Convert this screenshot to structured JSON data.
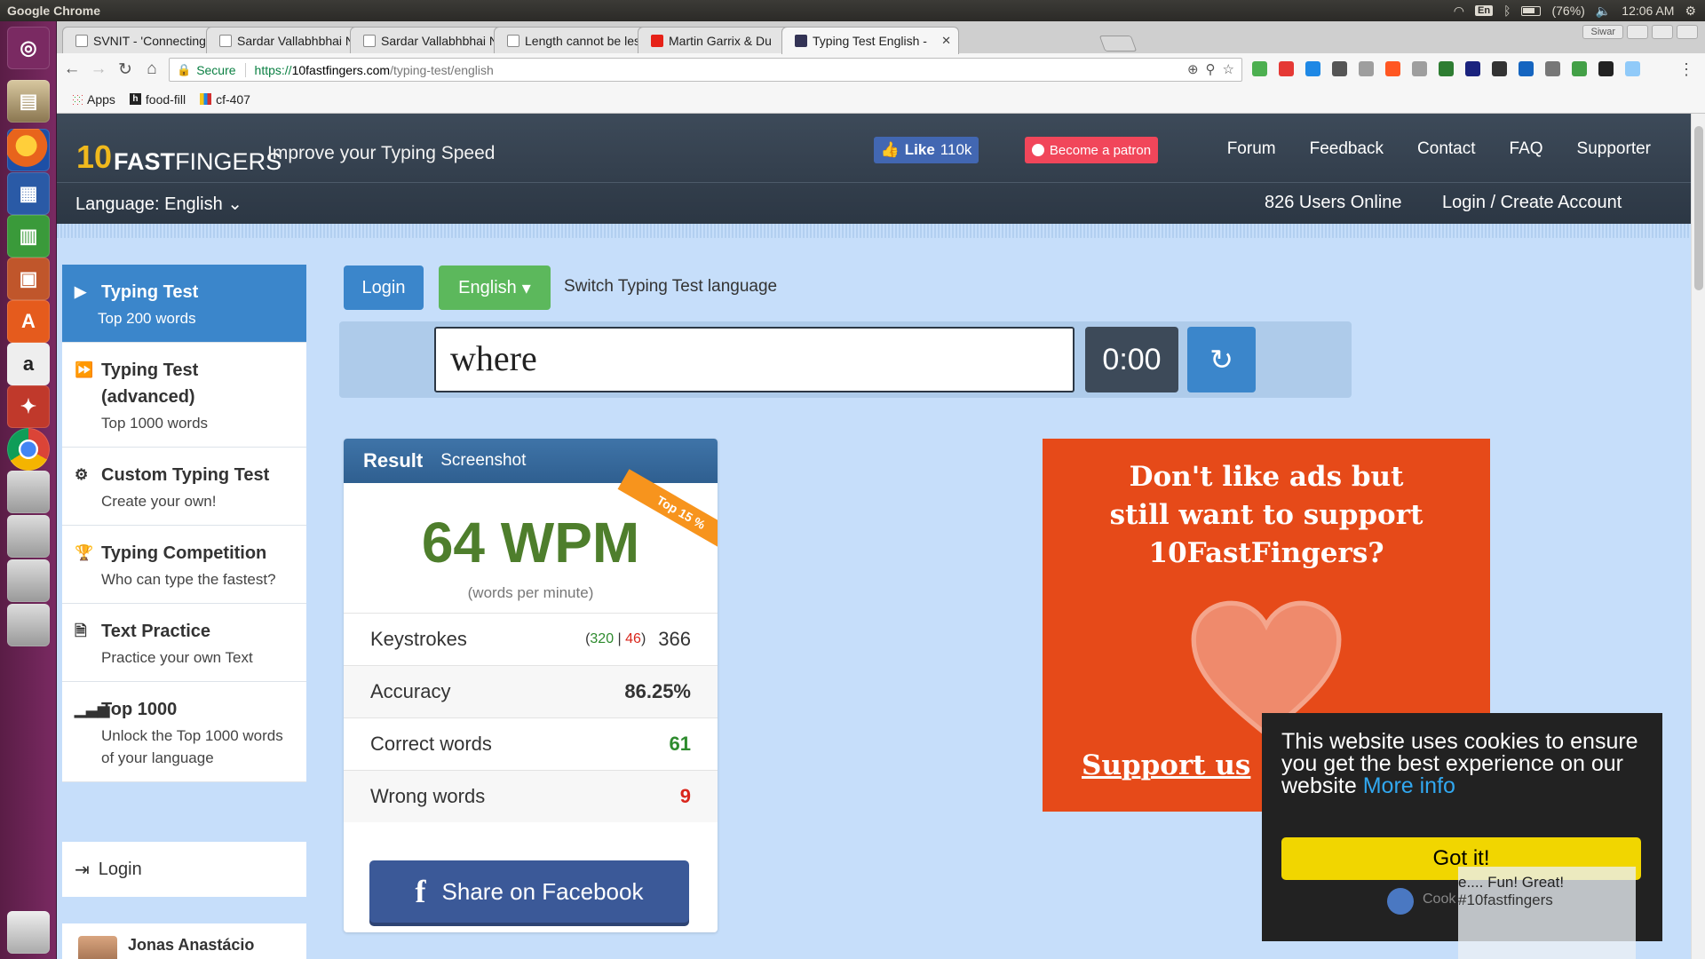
{
  "os": {
    "app_title": "Google Chrome",
    "lang": "En",
    "battery": "(76%)",
    "time": "12:06 AM"
  },
  "browser": {
    "tabs": [
      {
        "title": "SVNIT - 'Connecting I",
        "favicon": "doc-icon"
      },
      {
        "title": "Sardar Vallabhbhai N",
        "favicon": "shield-icon"
      },
      {
        "title": "Sardar Vallabhbhai N",
        "favicon": "doc-icon"
      },
      {
        "title": "Length cannot be les",
        "favicon": "doc-icon"
      },
      {
        "title": "Martin Garrix & Du",
        "favicon": "youtube-icon"
      },
      {
        "title": "Typing Test English -",
        "favicon": "tenff-icon"
      }
    ],
    "user_chip": "Siwar",
    "address": {
      "secure_label": "Secure",
      "scheme": "https://",
      "host": "10fastfingers.com",
      "path": "/typing-test/english"
    },
    "bookmarks": [
      {
        "label": "Apps"
      },
      {
        "label": "food-fill"
      },
      {
        "label": "cf-407"
      }
    ],
    "extension_colors": [
      "#4caf50",
      "#e53935",
      "#1e88e5",
      "#555555",
      "#9e9e9e",
      "#ff5722",
      "#9e9e9e",
      "#2e7d32",
      "#1a237e",
      "#333333",
      "#1565c0",
      "#777777",
      "#43a047",
      "#222222",
      "#90caf9"
    ]
  },
  "site": {
    "logo_ten": "10",
    "logo_fast": "FAST",
    "logo_fingers": "FINGERS",
    "tagline": "Improve your Typing Speed",
    "like_label": "Like",
    "like_count": "110k",
    "patron_label": "Become a patron",
    "nav": [
      "Forum",
      "Feedback",
      "Contact",
      "FAQ",
      "Supporter"
    ],
    "language_label": "Language: English",
    "users_online": "826 Users Online",
    "login_create": "Login / Create Account"
  },
  "sidebar": {
    "items": [
      {
        "title": "Typing Test",
        "sub": "Top 200 words",
        "icon": "play-icon"
      },
      {
        "title": "Typing Test (advanced)",
        "sub": "Top 1000 words",
        "icon": "fast-forward-icon"
      },
      {
        "title": "Custom Typing Test",
        "sub": "Create your own!",
        "icon": "gears-icon"
      },
      {
        "title": "Typing Competition",
        "sub": "Who can type the fastest?",
        "icon": "trophy-icon"
      },
      {
        "title": "Text Practice",
        "sub": "Practice your own Text",
        "icon": "file-icon"
      },
      {
        "title": "Top 1000",
        "sub": "Unlock the Top 1000 words of your language",
        "icon": "signal-bars-icon"
      }
    ],
    "login_label": "Login",
    "user_name": "Jonas Anastácio"
  },
  "main": {
    "login_btn": "Login",
    "language_btn": "English",
    "switch_note": "Switch Typing Test language",
    "input_value": "where",
    "timer": "0:00"
  },
  "result": {
    "title": "Result",
    "screenshot": "Screenshot",
    "ribbon": "Top 15 %",
    "wpm": "64 WPM",
    "wpm_sub": "(words per minute)",
    "keystrokes_label": "Keystrokes",
    "keystrokes_correct": "320",
    "keystrokes_wrong": "46",
    "keystrokes_total": "366",
    "accuracy_label": "Accuracy",
    "accuracy": "86.25%",
    "correct_label": "Correct words",
    "correct": "61",
    "wrong_label": "Wrong words",
    "wrong": "9",
    "share_label": "Share on Facebook"
  },
  "ad": {
    "line1": "Don't like ads but",
    "line2": "still want to support",
    "line3": "10FastFingers?",
    "cta": "Support us"
  },
  "cookie": {
    "text": "This website uses cookies to ensure you get the best experience on our website",
    "more": "More info",
    "button": "Got it!"
  },
  "chat_popup": {
    "line1": "e.... Fun! Great!",
    "line2": "#10fastfingers",
    "cook": "Cook"
  }
}
